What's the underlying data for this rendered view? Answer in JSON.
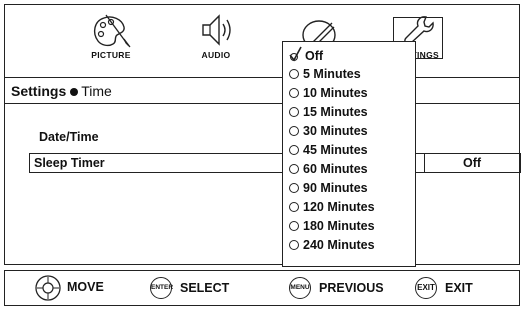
{
  "tabs": [
    {
      "label": "PICTURE",
      "icon": "palette-icon"
    },
    {
      "label": "AUDIO",
      "icon": "speaker-icon"
    },
    {
      "label": "",
      "icon": "satellite-dish-icon"
    },
    {
      "label": "TINGS",
      "icon": "wrench-icon"
    }
  ],
  "breadcrumb": {
    "section": "Settings",
    "item": "Time"
  },
  "rows": {
    "date_time": "Date/Time",
    "sleep_timer": {
      "label": "Sleep Timer",
      "value": "Off"
    }
  },
  "dropdown": {
    "selected": "Off",
    "options": [
      "Off",
      "5 Minutes",
      "10 Minutes",
      "15 Minutes",
      "30 Minutes",
      "45 Minutes",
      "60 Minutes",
      "90 Minutes",
      "120 Minutes",
      "180 Minutes",
      "240 Minutes"
    ]
  },
  "footer": {
    "move": {
      "button": "",
      "label": "MOVE"
    },
    "select": {
      "button": "ENTER",
      "label": "SELECT"
    },
    "previous": {
      "button": "MENU",
      "label": "PREVIOUS"
    },
    "exit": {
      "button": "EXIT",
      "label": "EXIT"
    }
  }
}
